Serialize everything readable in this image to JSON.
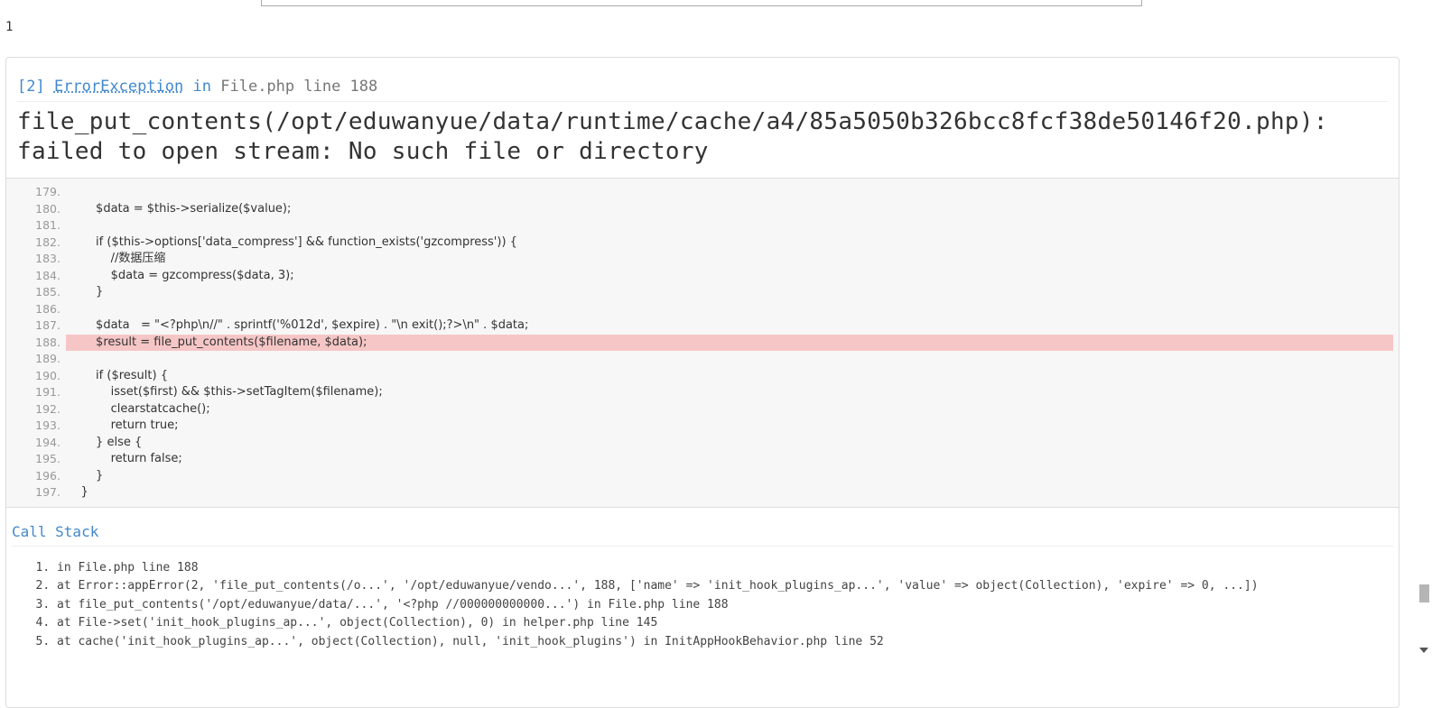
{
  "echo_output": "1",
  "exception": {
    "prefix": "[2]",
    "type": "ErrorException",
    "in_word": "in",
    "file": "File.php line 188",
    "message_line1": "file_put_contents(/opt/eduwanyue/data/runtime/cache/a4/85a5050b326bcc8fcf38de50146f20.php):",
    "message_line2": "failed to open stream: No such file or directory"
  },
  "source": {
    "active_line": "188.",
    "lines": [
      {
        "no": "179.",
        "code": ""
      },
      {
        "no": "180.",
        "code": "        $data = $this->serialize($value);"
      },
      {
        "no": "181.",
        "code": ""
      },
      {
        "no": "182.",
        "code": "        if ($this->options['data_compress'] && function_exists('gzcompress')) {"
      },
      {
        "no": "183.",
        "code": "            //数据压缩"
      },
      {
        "no": "184.",
        "code": "            $data = gzcompress($data, 3);"
      },
      {
        "no": "185.",
        "code": "        }"
      },
      {
        "no": "186.",
        "code": ""
      },
      {
        "no": "187.",
        "code": "        $data   = \"<?php\\n//\" . sprintf('%012d', $expire) . \"\\n exit();?>\\n\" . $data;"
      },
      {
        "no": "188.",
        "code": "        $result = file_put_contents($filename, $data);"
      },
      {
        "no": "189.",
        "code": ""
      },
      {
        "no": "190.",
        "code": "        if ($result) {"
      },
      {
        "no": "191.",
        "code": "            isset($first) && $this->setTagItem($filename);"
      },
      {
        "no": "192.",
        "code": "            clearstatcache();"
      },
      {
        "no": "193.",
        "code": "            return true;"
      },
      {
        "no": "194.",
        "code": "        } else {"
      },
      {
        "no": "195.",
        "code": "            return false;"
      },
      {
        "no": "196.",
        "code": "        }"
      },
      {
        "no": "197.",
        "code": "    }"
      }
    ]
  },
  "call_stack": {
    "title": "Call Stack",
    "items": [
      "in File.php line 188",
      "at Error::appError(2, 'file_put_contents(/o...', '/opt/eduwanyue/vendo...', 188, ['name' => 'init_hook_plugins_ap...', 'value' => object(Collection), 'expire' => 0, ...])",
      "at file_put_contents('/opt/eduwanyue/data/...', '<?php //000000000000...') in File.php line 188",
      "at File->set('init_hook_plugins_ap...', object(Collection), 0) in helper.php line 145",
      "at cache('init_hook_plugins_ap...', object(Collection), null, 'init_hook_plugins') in InitAppHookBehavior.php line 52"
    ]
  }
}
